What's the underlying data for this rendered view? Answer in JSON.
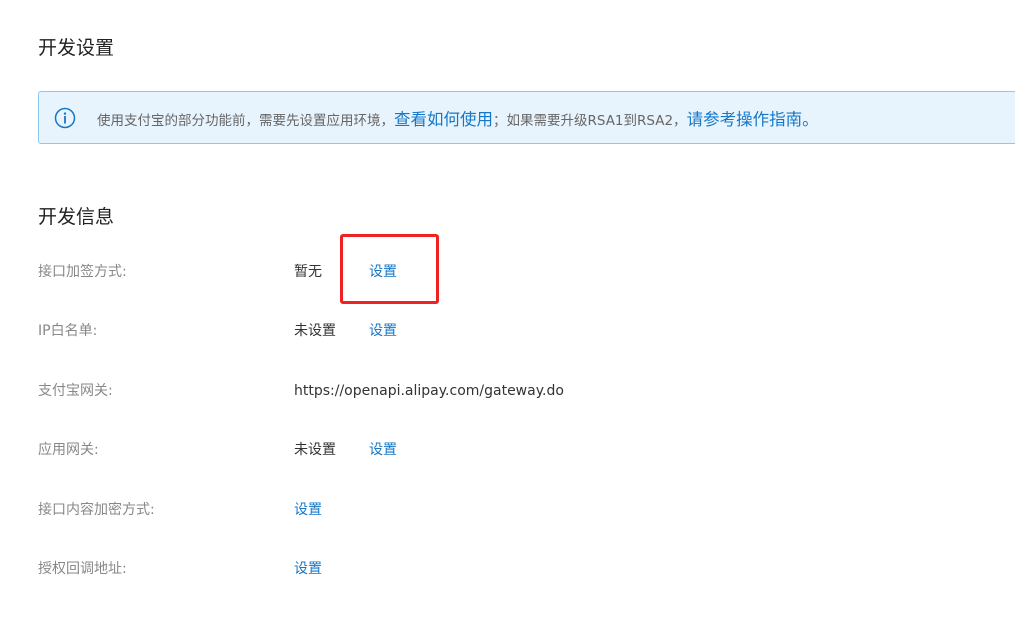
{
  "settings_section": {
    "title": "开发设置"
  },
  "notice": {
    "icon": "info-circle-icon",
    "text_before": "使用支付宝的部分功能前，需要先设置应用环境，",
    "link_how_to_use": "查看如何使用",
    "text_middle": "；如果需要升级RSA1到RSA2，",
    "link_guide": "请参考操作指南",
    "text_end": "。",
    "colors": {
      "background": "#e8f4fd",
      "border": "#8ec8f0",
      "link": "#1677c7"
    }
  },
  "info_section": {
    "title": "开发信息",
    "rows": [
      {
        "label": "接口加签方式:",
        "value": "暂无",
        "action": "设置"
      },
      {
        "label": "IP白名单:",
        "value": "未设置",
        "action": "设置"
      },
      {
        "label": "支付宝网关:",
        "value": "https://openapi.alipay.com/gateway.do",
        "action": ""
      },
      {
        "label": "应用网关:",
        "value": "未设置",
        "action": "设置"
      },
      {
        "label": "接口内容加密方式:",
        "value": "",
        "action": "设置"
      },
      {
        "label": "授权回调地址:",
        "value": "",
        "action": "设置"
      }
    ]
  },
  "annotation": {
    "highlight_color": "#ee2222"
  }
}
